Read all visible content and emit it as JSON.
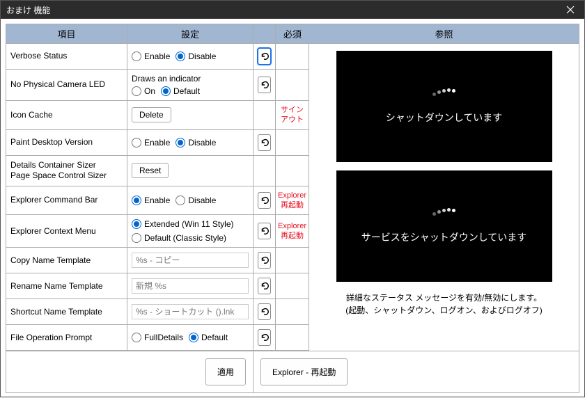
{
  "window": {
    "title": "おまけ 機能"
  },
  "headers": {
    "item": "項目",
    "setting": "設定",
    "required": "必須",
    "reference": "参照"
  },
  "rows": {
    "verbose_status": {
      "label": "Verbose Status",
      "opt_enable": "Enable",
      "opt_disable": "Disable",
      "selected": "Disable"
    },
    "no_phys_led": {
      "label": "No Physical Camera LED",
      "desc": "Draws an indicator",
      "opt_on": "On",
      "opt_default": "Default",
      "selected": "Default"
    },
    "icon_cache": {
      "label": "Icon Cache",
      "btn": "Delete",
      "required": "サインアウト"
    },
    "paint_desktop": {
      "label": "Paint Desktop Version",
      "opt_enable": "Enable",
      "opt_disable": "Disable",
      "selected": "Disable"
    },
    "details_container": {
      "label": "Details Container Sizer\nPage Space Control Sizer",
      "btn": "Reset"
    },
    "explorer_cmd_bar": {
      "label": "Explorer Command Bar",
      "opt_enable": "Enable",
      "opt_disable": "Disable",
      "selected": "Enable",
      "required": "Explorer\n再起動"
    },
    "explorer_ctx_menu": {
      "label": "Explorer Context Menu",
      "opt_ext": "Extended (Win 11 Style)",
      "opt_def": "Default (Classic Style)",
      "selected": "Extended",
      "required": "Explorer\n再起動"
    },
    "copy_name": {
      "label": "Copy Name Template",
      "placeholder": "%s - コピー"
    },
    "rename_name": {
      "label": "Rename Name Template",
      "placeholder": "新規 %s"
    },
    "shortcut_name": {
      "label": "Shortcut Name Template",
      "placeholder": "%s - ショートカット ().lnk"
    },
    "file_op_prompt": {
      "label": "File Operation Prompt",
      "opt_full": "FullDetails",
      "opt_def": "Default",
      "selected": "Default"
    }
  },
  "reference": {
    "shot1_text": "シャットダウンしています",
    "shot2_text": "サービスをシャットダウンしています",
    "caption1": "詳細なステータス メッセージを有効/無効にします。",
    "caption2": "(起動、シャットダウン、ログオン、およびログオフ)"
  },
  "buttons": {
    "apply": "適用",
    "restart_explorer": "Explorer - 再起動"
  }
}
